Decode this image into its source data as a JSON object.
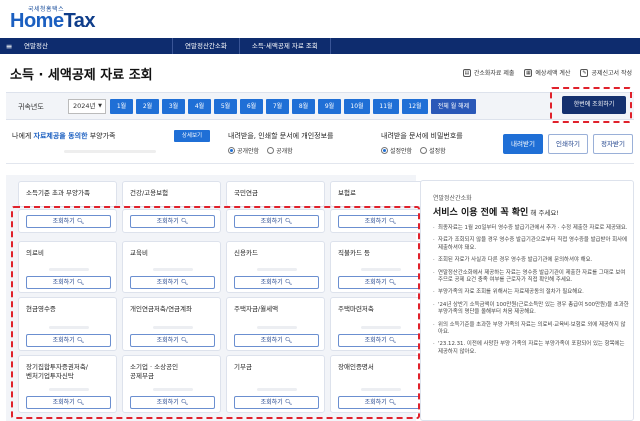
{
  "header": {
    "logo_sub": "국세청홈택스",
    "logo_home": "Home",
    "logo_tax": "Tax"
  },
  "nav": {
    "menu_icon": "≡",
    "home": "연말정산",
    "items": [
      "연말정산간소화",
      "소득·세액공제 자료 조회"
    ]
  },
  "page": {
    "title": "소득 · 세액공제 자료 조회",
    "links": [
      {
        "icon": "doc-icon",
        "label": "간소화자료 제출"
      },
      {
        "icon": "calc-icon",
        "label": "예상세액 계산"
      },
      {
        "icon": "form-icon",
        "label": "공제신고서 작성"
      }
    ]
  },
  "year_row": {
    "label": "귀속년도",
    "selected": "2024년",
    "months": [
      "1월",
      "2월",
      "3월",
      "4월",
      "5월",
      "6월",
      "7월",
      "8월",
      "9월",
      "10월",
      "11월",
      "12월"
    ],
    "all_toggle": "전체 월 해제",
    "all_query": "한번에 조회하기"
  },
  "options": {
    "dependent_prefix": "나에게 ",
    "dependent_highlight": "자료제공을 동의한",
    "dependent_suffix": " 부양가족",
    "detail_button": "상세보기",
    "print_title": "내려받을, 인쇄할 문서에 개인정보를",
    "print_radios": [
      "공개안함",
      "공개함"
    ],
    "password_title": "내려받을 문서에 비밀번호를",
    "password_radios": [
      "설정안함",
      "설정함"
    ],
    "download": "내려받기",
    "print": "인쇄하기",
    "clear": "정자받기"
  },
  "categories": [
    "소득기준 초과 부양가족",
    "건강/고용보험",
    "국민연금",
    "보험료"
  ],
  "query_label": "조회하기",
  "cards": [
    "의료비",
    "교육비",
    "신용카드",
    "직불카드 등",
    "현금영수증",
    "개인연금저축/연금계좌",
    "주택자금/월세액",
    "주택마련저축",
    "장기집합투자증권저축/\n벤처기업투자신탁",
    "소기업 · 소상공인\n공제부금",
    "기부금",
    "장애인증명서"
  ],
  "notice": {
    "caption": "연말정산간소화",
    "heading": "서비스 이용 전에 꼭 확인",
    "heading_suffix": " 해 주세요!",
    "items": [
      "최종자료는 1월 20일부터 영수증 발급기관에서 추가 · 수정 제출한 자료로 제공돼요.",
      "자료가 조회되지 않을 경우 영수증 발급기관으로부터 직접 영수증을 발급받아 회사에 제출하셔야 돼요.",
      "조회된 자료가 사실과 다른 경우 영수증 발급기관에 문의하셔야 해요.",
      "연말정산간소화에서 제공하는 자료는 영수증 발급기관이 제출한 자료를 그대로 보여주므로 공제 요건 충족 여부를 근로자가 직접 확인해 주세요.",
      "부양가족의 자료 조회를 위해서는 자료제공동의 절차가 필요해요.",
      "'24년 상반기 소득금액이 100만원(근로소득만 있는 경우 총급여 500만원)을 초과한 부양가족의 명단을 올해부터 처음 제공해요.",
      "위의 소득기준을 초과한 부양 가족의 자료는 의료비·교육비·보험료 외에 제공하지 않아요.",
      "'23.12.31. 이전에 사망한 부양 가족의 자료는 부양가족이 포함되어 있는 항목에는 제공하지 않아요."
    ]
  }
}
